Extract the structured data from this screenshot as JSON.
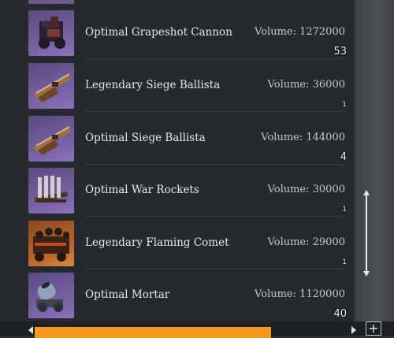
{
  "items": [
    {
      "name": "Optimal Grapeshot Cannon",
      "volume": "Volume: 1272000",
      "qty": "53",
      "icon": "grapeshot-cannon-icon"
    },
    {
      "name": "Legendary Siege Ballista",
      "volume": "Volume: 36000",
      "qty": "1",
      "icon": "siege-ballista-icon"
    },
    {
      "name": "Optimal Siege Ballista",
      "volume": "Volume: 144000",
      "qty": "4",
      "icon": "siege-ballista-icon"
    },
    {
      "name": "Optimal War Rockets",
      "volume": "Volume: 30000",
      "qty": "1",
      "icon": "war-rockets-icon"
    },
    {
      "name": "Legendary Flaming Comet",
      "volume": "Volume: 29000",
      "qty": "1",
      "icon": "flaming-comet-icon"
    },
    {
      "name": "Optimal Mortar",
      "volume": "Volume: 1120000",
      "qty": "40",
      "icon": "mortar-icon"
    }
  ],
  "colors": {
    "purple_frame": "#7b63a8",
    "orange_frame": "#c2682a",
    "accent_orange": "#f39a1d"
  },
  "bottom_bar": {
    "button_label": "",
    "plus_label": "+"
  }
}
